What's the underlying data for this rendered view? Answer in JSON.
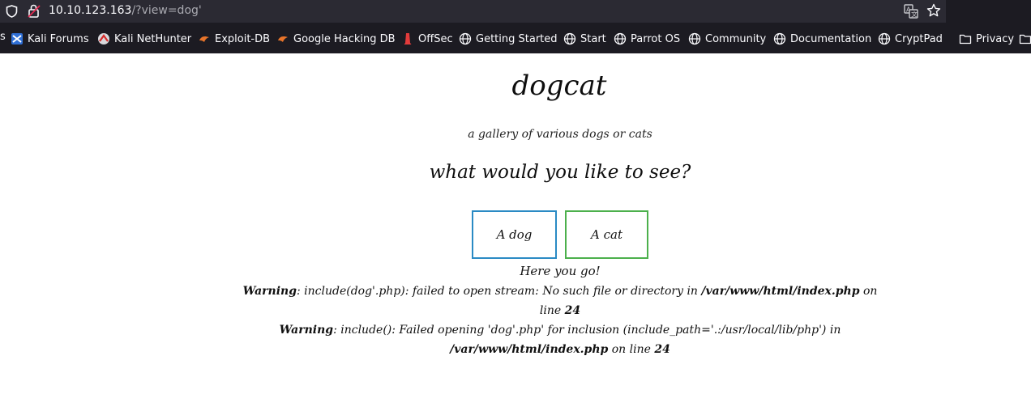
{
  "browser": {
    "url_host": "10.10.123.163",
    "url_path": "/?view=dog'"
  },
  "bookmarks": {
    "leading_fragment": "s",
    "items": [
      {
        "label": "Kali Forums",
        "icon": "kali-forums-icon"
      },
      {
        "label": "Kali NetHunter",
        "icon": "kali-nethunter-icon"
      },
      {
        "label": "Exploit-DB",
        "icon": "exploit-db-icon"
      },
      {
        "label": "Google Hacking DB",
        "icon": "google-hacking-db-icon"
      },
      {
        "label": "OffSec",
        "icon": "offsec-icon"
      },
      {
        "label": "Getting Started",
        "icon": "globe-icon"
      },
      {
        "label": "Start",
        "icon": "globe-icon"
      },
      {
        "label": "Parrot OS",
        "icon": "globe-icon"
      },
      {
        "label": "Community",
        "icon": "globe-icon"
      },
      {
        "label": "Documentation",
        "icon": "globe-icon"
      },
      {
        "label": "CryptPad",
        "icon": "globe-icon"
      },
      {
        "label": "Privacy",
        "icon": "folder-icon"
      }
    ]
  },
  "page": {
    "title": "dogcat",
    "subtitle": "a gallery of various dogs or cats",
    "question": "what would you like to see?",
    "dog_button": "A dog",
    "cat_button": "A cat",
    "here_text": "Here you go!",
    "warning1": {
      "label": "Warning",
      "message": ": include(dog'.php): failed to open stream: No such file or directory in ",
      "path": "/var/www/html/index.php",
      "on_line": " on line ",
      "line": "24"
    },
    "warning2": {
      "label": "Warning",
      "message": ": include(): Failed opening 'dog'.php' for inclusion (include_path='.:/usr/local/lib/php') in ",
      "path": "/var/www/html/index.php",
      "on_line": " on line ",
      "line": "24"
    }
  },
  "colors": {
    "dog_button_border": "#2a8ac4",
    "cat_button_border": "#4cb04c",
    "toolbar_bg": "#1c1b22"
  }
}
